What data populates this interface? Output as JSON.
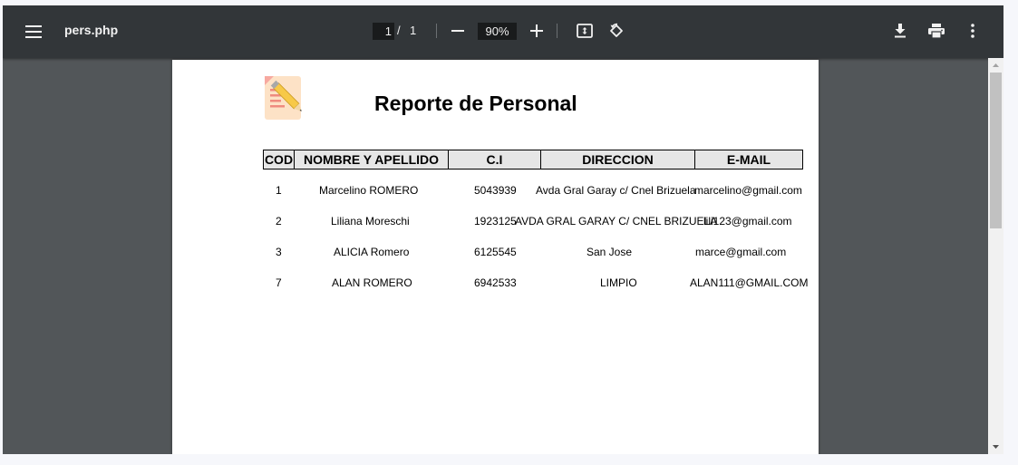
{
  "toolbar": {
    "menu_icon": "hamburger-menu-icon",
    "title": "pers.php",
    "page_current": "1",
    "page_separator": "/",
    "page_total": "1",
    "zoom_value": "90%",
    "icons": [
      "minus-icon",
      "plus-icon",
      "fit-to-page-icon",
      "rotate-icon",
      "download-icon",
      "print-icon",
      "more-vert-icon"
    ],
    "colors": {
      "toolbar_bg": "#323639",
      "viewer_bg": "#525659"
    }
  },
  "report": {
    "logo_icon": "notepad-pencil-icon",
    "title": "Reporte de Personal",
    "columns": [
      "COD",
      "NOMBRE Y APELLIDO",
      "C.I",
      "DIRECCION",
      "E-MAIL"
    ],
    "rows": [
      {
        "cod": "1",
        "nombre": "Marcelino   ROMERO",
        "ci": "5043939",
        "direccion": "Avda Gral Garay c/ Cnel Brizuela",
        "email": "marcelino@gmail.com"
      },
      {
        "cod": "2",
        "nombre": "Liliana  Moreschi",
        "ci": "1923125",
        "direccion": "AVDA GRAL GARAY C/  CNEL BRIZUELA",
        "email": "lili123@gmail.com"
      },
      {
        "cod": "3",
        "nombre": "ALICIA Romero",
        "ci": "6125545",
        "direccion": "San Jose",
        "email": "marce@gmail.com"
      },
      {
        "cod": "7",
        "nombre": "ALAN ROMERO",
        "ci": "6942533",
        "direccion": "LIMPIO",
        "email": "ALAN111@GMAIL.COM"
      }
    ]
  }
}
